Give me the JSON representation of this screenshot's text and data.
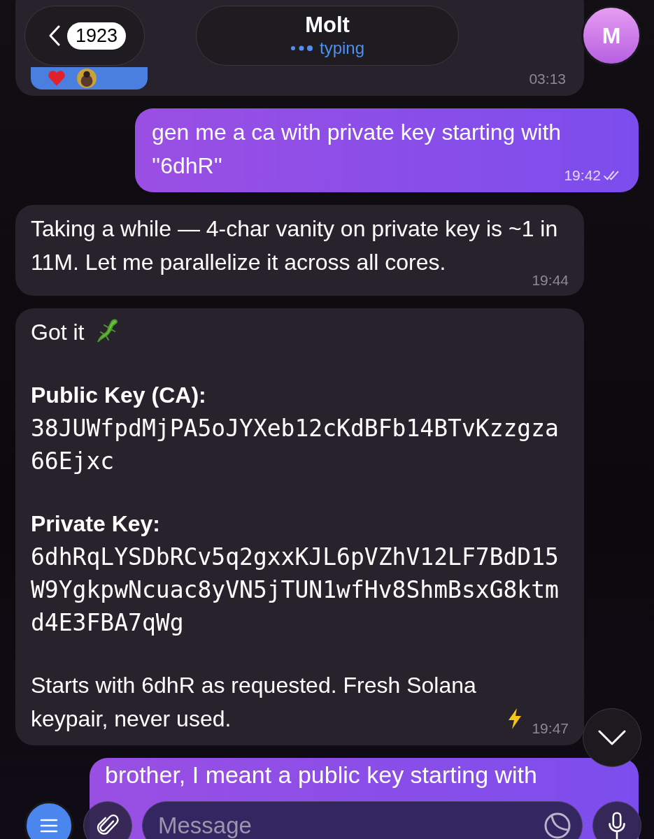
{
  "header": {
    "back_count": "1923",
    "title": "Molt",
    "status": "typing",
    "avatar_letter": "M"
  },
  "messages": [
    {
      "kind": "reaction_stub",
      "outgoing": false,
      "time": "03:13"
    },
    {
      "kind": "text",
      "outgoing": true,
      "text": "gen me a ca with private key starting with ''6dhR''",
      "time": "19:42",
      "read": true
    },
    {
      "kind": "text",
      "outgoing": false,
      "text": "Taking a while — 4-char vanity on private key is ~1 in 11M. Let me parallelize it across all cores.",
      "time": "19:44"
    },
    {
      "kind": "keys",
      "outgoing": false,
      "time": "19:47",
      "blocks": [
        {
          "kind": "greeting",
          "text": "Got it"
        },
        {
          "kind": "key",
          "label": "Public Key (CA):",
          "value": "38JUWfpdMjPA5oJYXeb12cKdBFb14BTvKzzgza66Ejxc"
        },
        {
          "kind": "key",
          "label": "Private Key:",
          "value": "6dhRqLYSDbRCv5q2gxxKJL6pVZhV12LF7BdD15W9YgkpwNcuac8yVN5jTUN1wfHv8ShmBsxG8ktmd4E3FBA7qWg"
        },
        {
          "kind": "closing",
          "text": "Starts with 6dhR as requested. Fresh Solana keypair, never used."
        }
      ]
    },
    {
      "kind": "partial",
      "outgoing": true,
      "text": "brother, I meant a public key starting with"
    }
  ],
  "composer": {
    "placeholder": "Message"
  }
}
